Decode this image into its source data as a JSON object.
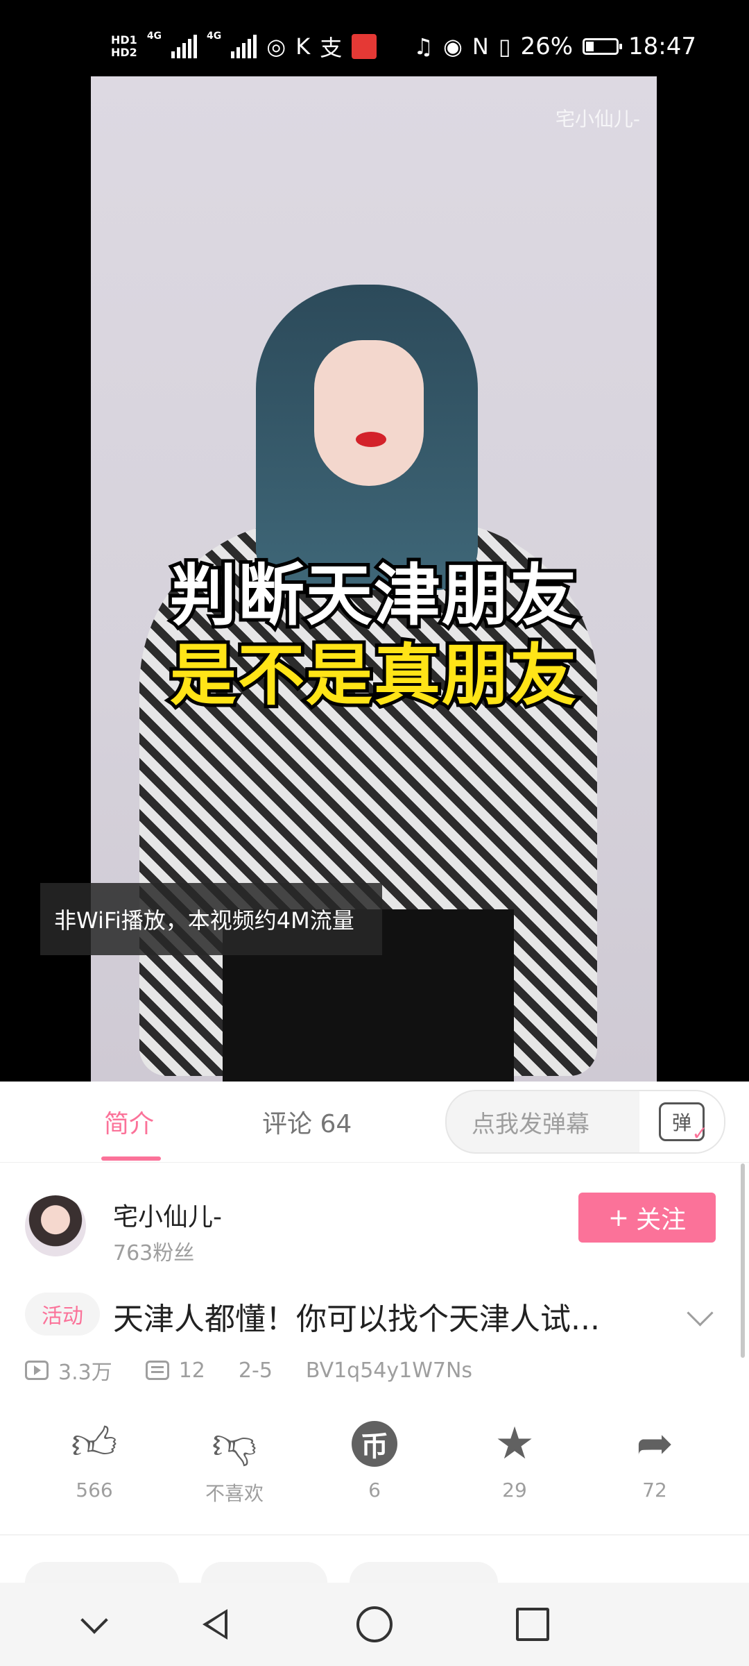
{
  "status_bar": {
    "hd1": "HD1",
    "hd2": "HD2",
    "net1": "4G",
    "net2": "4G",
    "app_icons": [
      "hotspot-icon",
      "k-icon",
      "alipay-icon",
      "app-red-icon"
    ],
    "right_icons": [
      "headphones-icon",
      "eye-icon",
      "nfc-icon",
      "vibrate-icon"
    ],
    "battery_percent_text": "26%",
    "battery_level": 0.26,
    "time": "18:47"
  },
  "video": {
    "watermark": "宅小仙儿-",
    "caption_line1": "判断天津朋友",
    "caption_line2": "是不是真朋友",
    "toast": "非WiFi播放，本视频约4M流量"
  },
  "tabs": {
    "intro": "简介",
    "comments": "评论 64",
    "danmaku_placeholder": "点我发弹幕",
    "danmaku_icon_text": "弹"
  },
  "uploader": {
    "name": "宅小仙儿-",
    "fans": "763粉丝",
    "follow_label": "关注",
    "follow_plus": "+"
  },
  "video_info": {
    "tag": "活动",
    "title": "天津人都懂！你可以找个天津人试...",
    "views": "3.3万",
    "danmaku_count": "12",
    "date": "2-5",
    "bvid": "BV1q54y1W7Ns"
  },
  "actions": {
    "like": "566",
    "dislike": "不喜欢",
    "coin": "6",
    "coin_glyph": "币",
    "favorite": "29",
    "share": "72"
  },
  "colors": {
    "accent": "#fb7299",
    "caption_yellow": "#ffe417"
  }
}
